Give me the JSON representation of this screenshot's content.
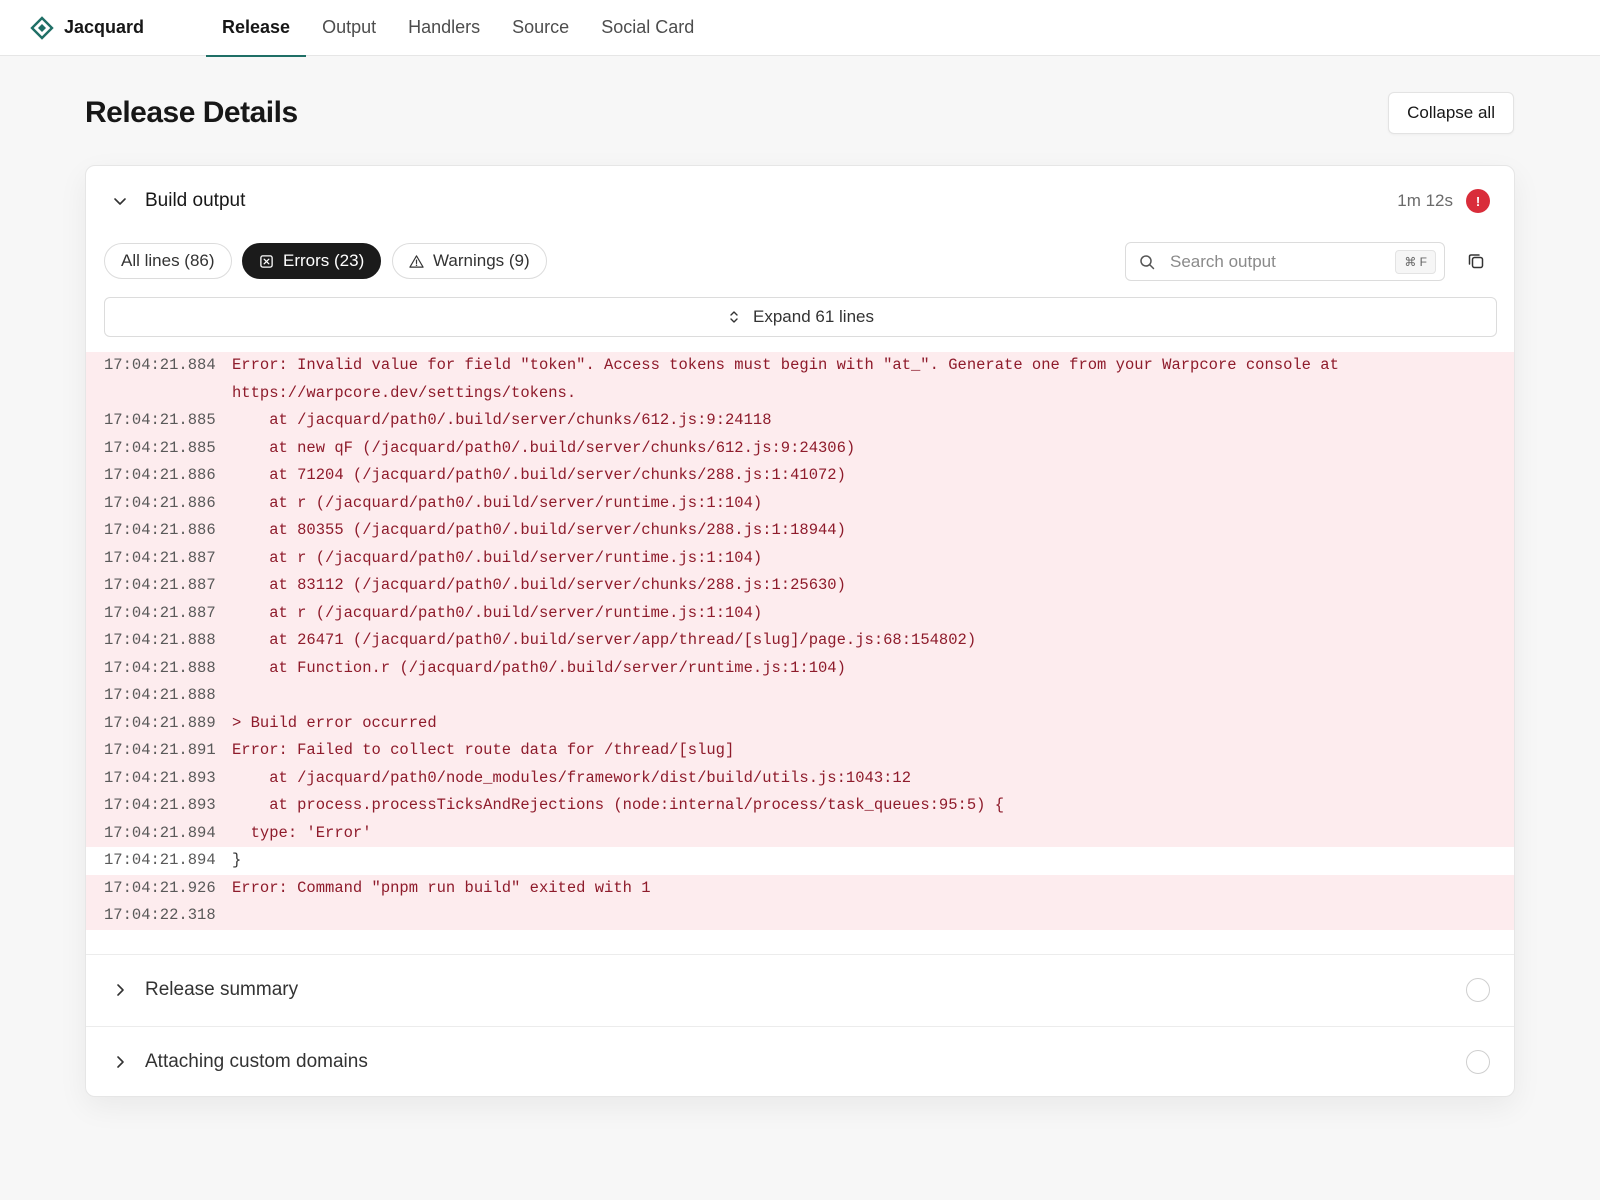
{
  "nav": {
    "brand": "Jacquard",
    "tabs": [
      {
        "label": "Release",
        "active": true
      },
      {
        "label": "Output"
      },
      {
        "label": "Handlers"
      },
      {
        "label": "Source"
      },
      {
        "label": "Social Card"
      }
    ]
  },
  "page": {
    "title": "Release Details",
    "collapse_all": "Collapse all"
  },
  "build": {
    "title": "Build output",
    "duration": "1m 12s",
    "status": "error",
    "error_badge": "!",
    "filters": {
      "all": "All lines (86)",
      "errors": "Errors (23)",
      "warnings": "Warnings (9)"
    },
    "search_placeholder": "Search output",
    "shortcut": "⌘ F",
    "expand_label": "Expand 61 lines",
    "lines": [
      {
        "ts": "17:04:21.884",
        "msg": "Error: Invalid value for field \"token\". Access tokens must begin with \"at_\". Generate one from your Warpcore console at https://warpcore.dev/settings/tokens.",
        "error": true
      },
      {
        "ts": "17:04:21.885",
        "msg": "    at /jacquard/path0/.build/server/chunks/612.js:9:24118",
        "error": true
      },
      {
        "ts": "17:04:21.885",
        "msg": "    at new qF (/jacquard/path0/.build/server/chunks/612.js:9:24306)",
        "error": true
      },
      {
        "ts": "17:04:21.886",
        "msg": "    at 71204 (/jacquard/path0/.build/server/chunks/288.js:1:41072)",
        "error": true
      },
      {
        "ts": "17:04:21.886",
        "msg": "    at r (/jacquard/path0/.build/server/runtime.js:1:104)",
        "error": true
      },
      {
        "ts": "17:04:21.886",
        "msg": "    at 80355 (/jacquard/path0/.build/server/chunks/288.js:1:18944)",
        "error": true
      },
      {
        "ts": "17:04:21.887",
        "msg": "    at r (/jacquard/path0/.build/server/runtime.js:1:104)",
        "error": true
      },
      {
        "ts": "17:04:21.887",
        "msg": "    at 83112 (/jacquard/path0/.build/server/chunks/288.js:1:25630)",
        "error": true
      },
      {
        "ts": "17:04:21.887",
        "msg": "    at r (/jacquard/path0/.build/server/runtime.js:1:104)",
        "error": true
      },
      {
        "ts": "17:04:21.888",
        "msg": "    at 26471 (/jacquard/path0/.build/server/app/thread/[slug]/page.js:68:154802)",
        "error": true
      },
      {
        "ts": "17:04:21.888",
        "msg": "    at Function.r (/jacquard/path0/.build/server/runtime.js:1:104)",
        "error": true
      },
      {
        "ts": "17:04:21.888",
        "msg": "",
        "error": true
      },
      {
        "ts": "17:04:21.889",
        "msg": "> Build error occurred",
        "error": true
      },
      {
        "ts": "17:04:21.891",
        "msg": "Error: Failed to collect route data for /thread/[slug]",
        "error": true
      },
      {
        "ts": "17:04:21.893",
        "msg": "    at /jacquard/path0/node_modules/framework/dist/build/utils.js:1043:12",
        "error": true
      },
      {
        "ts": "17:04:21.893",
        "msg": "    at process.processTicksAndRejections (node:internal/process/task_queues:95:5) {",
        "error": true
      },
      {
        "ts": "17:04:21.894",
        "msg": "  type: 'Error'",
        "error": true
      },
      {
        "ts": "17:04:21.894",
        "msg": "}",
        "error": false
      },
      {
        "ts": "17:04:21.926",
        "msg": "Error: Command \"pnpm run build\" exited with 1",
        "error": true
      },
      {
        "ts": "17:04:22.318",
        "msg": "",
        "error": true
      }
    ]
  },
  "sections": [
    {
      "title": "Release summary"
    },
    {
      "title": "Attaching custom domains"
    }
  ],
  "colors": {
    "accent": "#1f6f66",
    "error": "#d92d3a",
    "error_row": "#fdecee",
    "error_text": "#8e1b2b"
  }
}
